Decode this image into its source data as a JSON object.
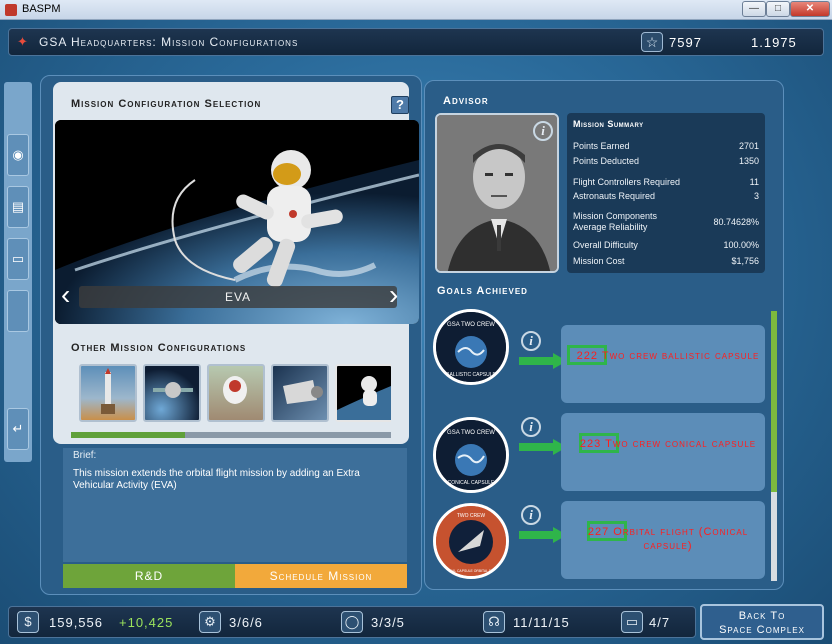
{
  "window": {
    "title": "BASPM",
    "min_label": "—",
    "max_label": "□",
    "close_label": "✕"
  },
  "header": {
    "title": "GSA Headquarters: Mission Configurations",
    "star_icon": "star-icon",
    "points": "7597",
    "date_value": "1.1975"
  },
  "left_strip": {
    "items": [
      {
        "icon": "radar-icon",
        "glyph": "◉"
      },
      {
        "icon": "document-icon",
        "glyph": "▤"
      },
      {
        "icon": "folder-icon",
        "glyph": "▭"
      },
      {
        "icon": "blank-tab-icon",
        "glyph": ""
      },
      {
        "icon": "return-icon",
        "glyph": "↵"
      }
    ]
  },
  "config": {
    "title": "Mission Configuration Selection",
    "help_label": "?",
    "hero_caption": "EVA",
    "other_title": "Other Mission Configurations",
    "thumbnails": [
      "rocket-launch-thumbnail",
      "satellite-thumbnail",
      "astronaut-capsule-thumbnail",
      "capsule-docking-thumbnail",
      "eva-thumbnail"
    ],
    "progress_fraction": 0.357,
    "brief_label": "Brief:",
    "brief_text": "This mission extends the orbital flight mission by adding an Extra Vehicular Activity (EVA)",
    "rd_label": "R&D",
    "schedule_label": "Schedule Mission"
  },
  "advisor": {
    "title": "Advisor",
    "info_label": "i",
    "summary": {
      "title": "Mission Summary",
      "rows": [
        {
          "label": "Points Earned",
          "value": "2701"
        },
        {
          "label": "Points Deducted",
          "value": "1350"
        },
        {
          "label": "Flight Controllers Required",
          "value": "11"
        },
        {
          "label": "Astronauts Required",
          "value": "3"
        },
        {
          "label": "Mission Components Average Reliability",
          "value": "80.74628%"
        },
        {
          "label": "Overall Difficulty",
          "value": "100.00%"
        },
        {
          "label": "Mission Cost",
          "value": "$1,756"
        }
      ]
    }
  },
  "goals": {
    "title": "Goals Achieved",
    "items": [
      {
        "number": "222",
        "text": "Two crew ballistic capsule",
        "badge_top": "GSA TWO CREW",
        "badge_bottom": "BALLISTIC CAPSULE"
      },
      {
        "number": "223",
        "text": "Two crew conical capsule",
        "badge_top": "GSA TWO CREW",
        "badge_bottom": "CONICAL CAPSULE"
      },
      {
        "number": "227",
        "text": "Orbital flight (Conical capsule)",
        "badge_top": "TWO CREW",
        "badge_bottom": "CONICAL CAPSULE ORBITAL FLIGHT"
      }
    ],
    "scroll_fraction": 0.67
  },
  "bottom_bar": {
    "money_icon": "$",
    "money": "159,556",
    "money_delta": "+10,425",
    "rd_icon": "⚙",
    "rd_value": "3/6/6",
    "capsule_icon": "◯",
    "capsule_value": "3/3/5",
    "headset_icon": "☊",
    "headset_value": "11/11/15",
    "folder_icon": "▭",
    "folder_value": "4/7",
    "back_label_1": "Back To",
    "back_label_2": "Space Complex"
  }
}
